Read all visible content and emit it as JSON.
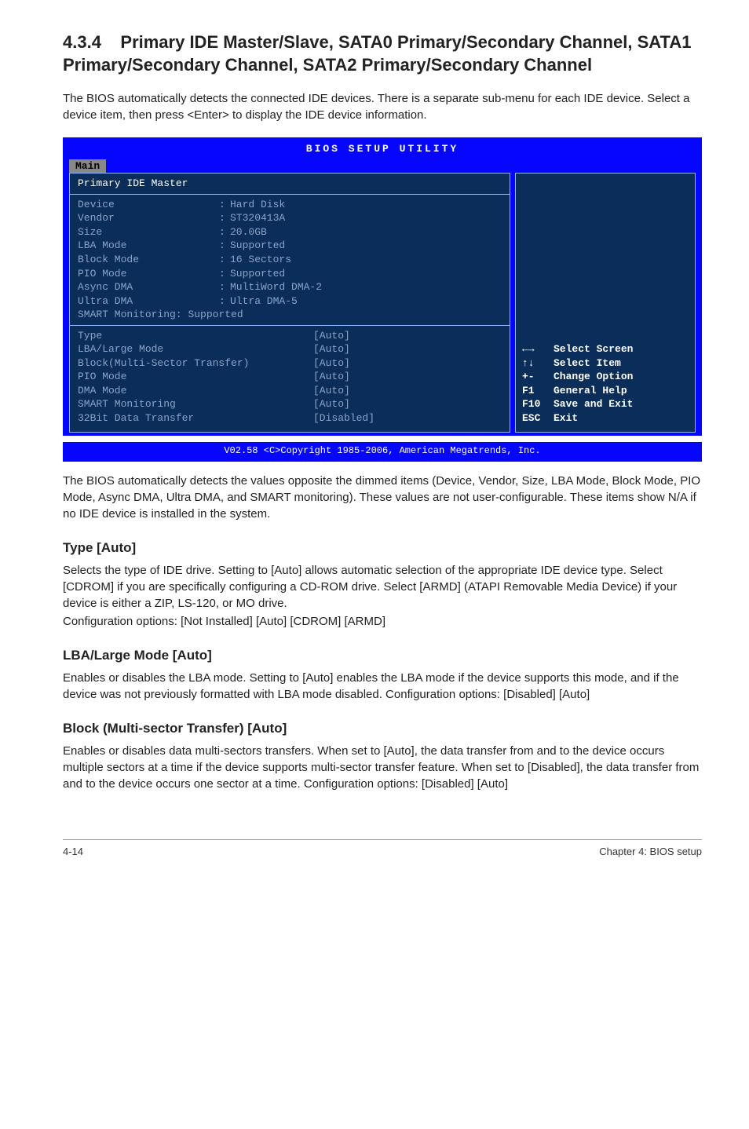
{
  "section": {
    "number": "4.3.4",
    "title_rest": "Primary IDE Master/Slave, SATA0 Primary/Secondary Channel, SATA1 Primary/Secondary Channel, SATA2 Primary/Secondary Channel"
  },
  "intro": "The BIOS automatically detects the connected IDE devices. There is a separate sub-menu for each IDE device. Select a device item, then press <Enter> to display the IDE device information.",
  "bios": {
    "title": "BIOS SETUP UTILITY",
    "menu": "Main",
    "panel_header": "Primary IDE Master",
    "info": [
      {
        "label": "Device",
        "value": "Hard Disk"
      },
      {
        "label": "Vendor",
        "value": "ST320413A"
      },
      {
        "label": "Size",
        "value": "20.0GB"
      },
      {
        "label": "LBA Mode",
        "value": "Supported"
      },
      {
        "label": "Block Mode",
        "value": "16 Sectors"
      },
      {
        "label": "PIO Mode",
        "value": "Supported"
      },
      {
        "label": "Async DMA",
        "value": "MultiWord DMA-2"
      },
      {
        "label": "Ultra DMA",
        "value": "Ultra DMA-5"
      },
      {
        "label": "SMART Monitoring",
        "value": "Supported",
        "no_colon_gap": true
      }
    ],
    "settings": [
      {
        "label": "Type",
        "value": "[Auto]"
      },
      {
        "label": "LBA/Large Mode",
        "value": "[Auto]"
      },
      {
        "label": "Block(Multi-Sector Transfer)",
        "value": "[Auto]"
      },
      {
        "label": "PIO Mode",
        "value": "[Auto]"
      },
      {
        "label": "DMA Mode",
        "value": "[Auto]"
      },
      {
        "label": "SMART Monitoring",
        "value": "[Auto]"
      },
      {
        "label": "32Bit Data Transfer",
        "value": "[Disabled]"
      }
    ],
    "help": [
      {
        "key": "←→",
        "text": "Select Screen"
      },
      {
        "key": "↑↓",
        "text": "Select Item"
      },
      {
        "key": "+-",
        "text": "Change Option"
      },
      {
        "key": "F1",
        "text": "General Help"
      },
      {
        "key": "F10",
        "text": "Save and Exit"
      },
      {
        "key": "ESC",
        "text": "Exit"
      }
    ],
    "footer": "V02.58 <C>Copyright 1985-2006, American Megatrends, Inc."
  },
  "para_after_bios": "The BIOS automatically detects the values opposite the dimmed items (Device, Vendor, Size, LBA Mode, Block Mode, PIO Mode, Async DMA, Ultra DMA, and SMART monitoring). These values are not user-configurable. These items show N/A if no IDE device is installed in the system.",
  "subs": {
    "type": {
      "heading": "Type [Auto]",
      "p1": "Selects the type of IDE drive. Setting to [Auto] allows automatic selection of the appropriate IDE device type. Select [CDROM] if you are specifically configuring a CD-ROM drive. Select [ARMD] (ATAPI Removable Media Device) if your device is either a ZIP, LS-120, or MO drive.",
      "p2": "Configuration options: [Not Installed] [Auto] [CDROM] [ARMD]"
    },
    "lba": {
      "heading": "LBA/Large Mode [Auto]",
      "p1": "Enables or disables the LBA mode. Setting to [Auto] enables the LBA mode if the device supports this mode, and if the device was not previously formatted with LBA mode disabled. Configuration options: [Disabled] [Auto]"
    },
    "block": {
      "heading": "Block (Multi-sector Transfer) [Auto]",
      "p1": "Enables or disables data multi-sectors transfers. When set to [Auto], the data transfer from and to the device occurs multiple sectors at a time if the device supports multi-sector transfer feature. When set to [Disabled], the data transfer from and to the device occurs one sector at a time. Configuration options: [Disabled] [Auto]"
    }
  },
  "footer": {
    "left": "4-14",
    "right": "Chapter 4: BIOS setup"
  }
}
